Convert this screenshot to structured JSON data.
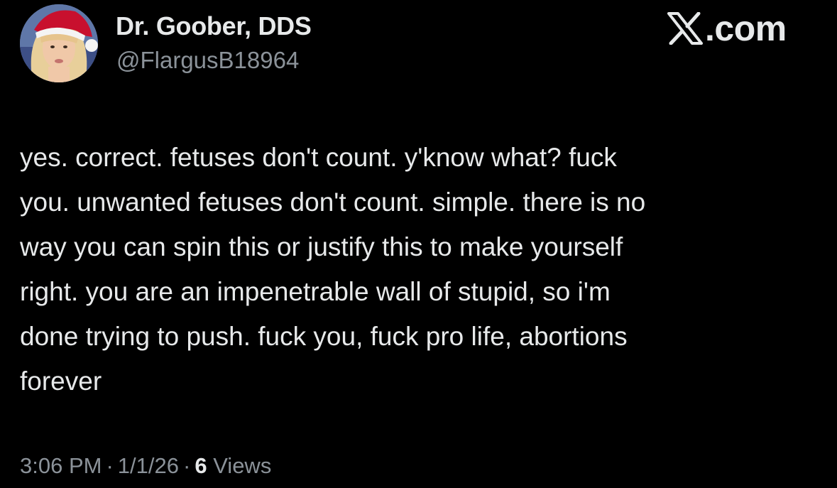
{
  "author": {
    "display_name": "Dr. Goober, DDS",
    "handle": "@FlargusB18964",
    "avatar_icon": "profile-photo-santa-hat"
  },
  "brand": {
    "logo_icon": "x-logo-icon",
    "text": ".com"
  },
  "tweet": {
    "text": "yes. correct. fetuses don't count. y'know what? fuck\nyou. unwanted fetuses don't count. simple. there is no\nway you can spin this or justify this to make yourself\nright. you are an impenetrable wall of stupid, so i'm\ndone trying to push. fuck you, fuck pro life, abortions\nforever",
    "time": "3:06 PM",
    "date": "1/1/26",
    "separator": "·",
    "views_count": "6",
    "views_label": "Views"
  },
  "colors": {
    "background": "#000000",
    "primary_text": "#e7e9ea",
    "secondary_text": "#8b9299"
  }
}
